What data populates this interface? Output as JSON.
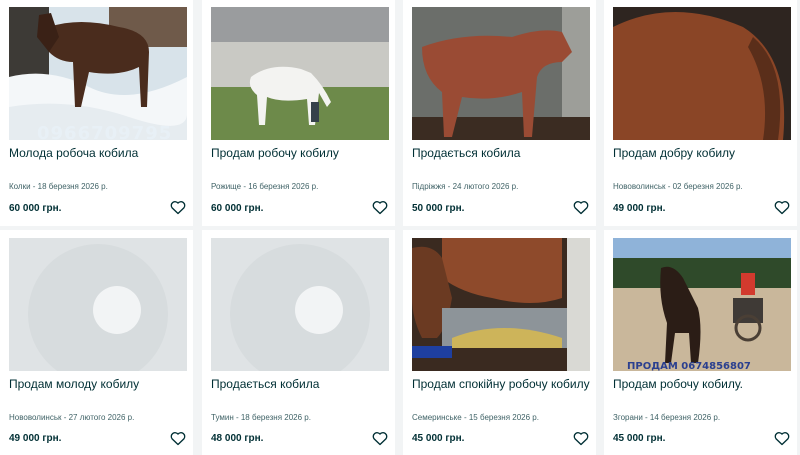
{
  "listings": [
    {
      "title": "Молода робоча кобила",
      "meta": "Колки - 18 березня 2026 р.",
      "price": "60 000 грн.",
      "photo_overlay": "0966709795"
    },
    {
      "title": "Продам робочу кобилу",
      "meta": "Рожище - 16 березня 2026 р.",
      "price": "60 000 грн."
    },
    {
      "title": "Продається кобила",
      "meta": "Підріжжя - 24 лютого 2026 р.",
      "price": "50 000 грн."
    },
    {
      "title": "Продам добру кобилу",
      "meta": "Нововолинськ - 02 березня 2026 р.",
      "price": "49 000 грн."
    },
    {
      "title": "Продам молоду кобилу",
      "meta": "Нововолинськ - 27 лютого 2026 р.",
      "price": "49 000 грн."
    },
    {
      "title": "Продається кобила",
      "meta": "Тумин - 18 березня 2026 р.",
      "price": "48 000 грн."
    },
    {
      "title": "Продам спокійну робочу кобилу",
      "meta": "Семеринське - 15 березня 2026 р.",
      "price": "45 000 грн."
    },
    {
      "title": "Продам робочу кобилу.",
      "meta": "Згорани - 14 березня 2026 р.",
      "price": "45 000 грн.",
      "photo_overlay": "ПРОДАМ 0674856807"
    }
  ],
  "icons": {
    "favorite": "heart-outline-icon",
    "placeholder": "image-placeholder-icon"
  },
  "colors": {
    "text": "#002f34",
    "meta": "#406367",
    "background": "#f2f4f5",
    "card": "#ffffff",
    "placeholder": "#d7dcde"
  }
}
